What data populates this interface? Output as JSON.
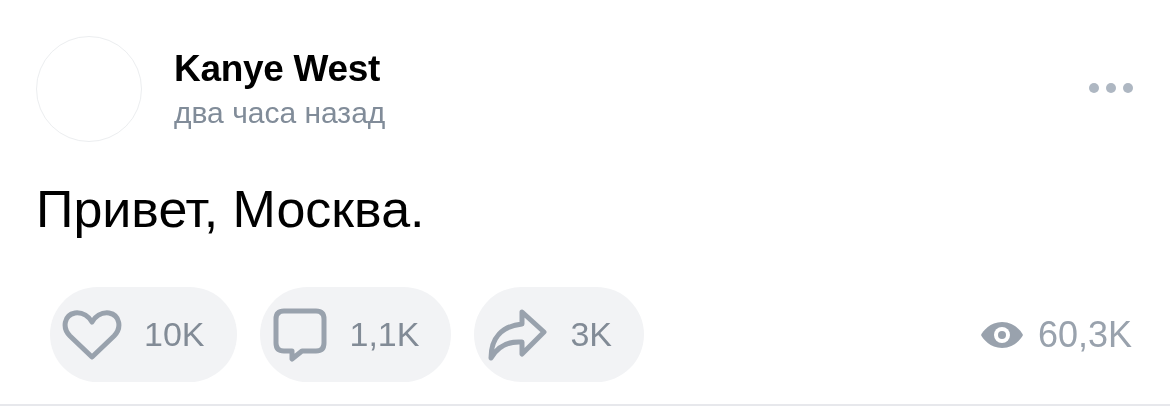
{
  "post": {
    "author": "Kanye West",
    "time": "два часа назад",
    "text": "Привет, Москва.",
    "actions": [
      {
        "kind": "like",
        "count": "10K"
      },
      {
        "kind": "comment",
        "count": "1,1K"
      },
      {
        "kind": "share",
        "count": "3K"
      }
    ],
    "views": "60,3K"
  }
}
